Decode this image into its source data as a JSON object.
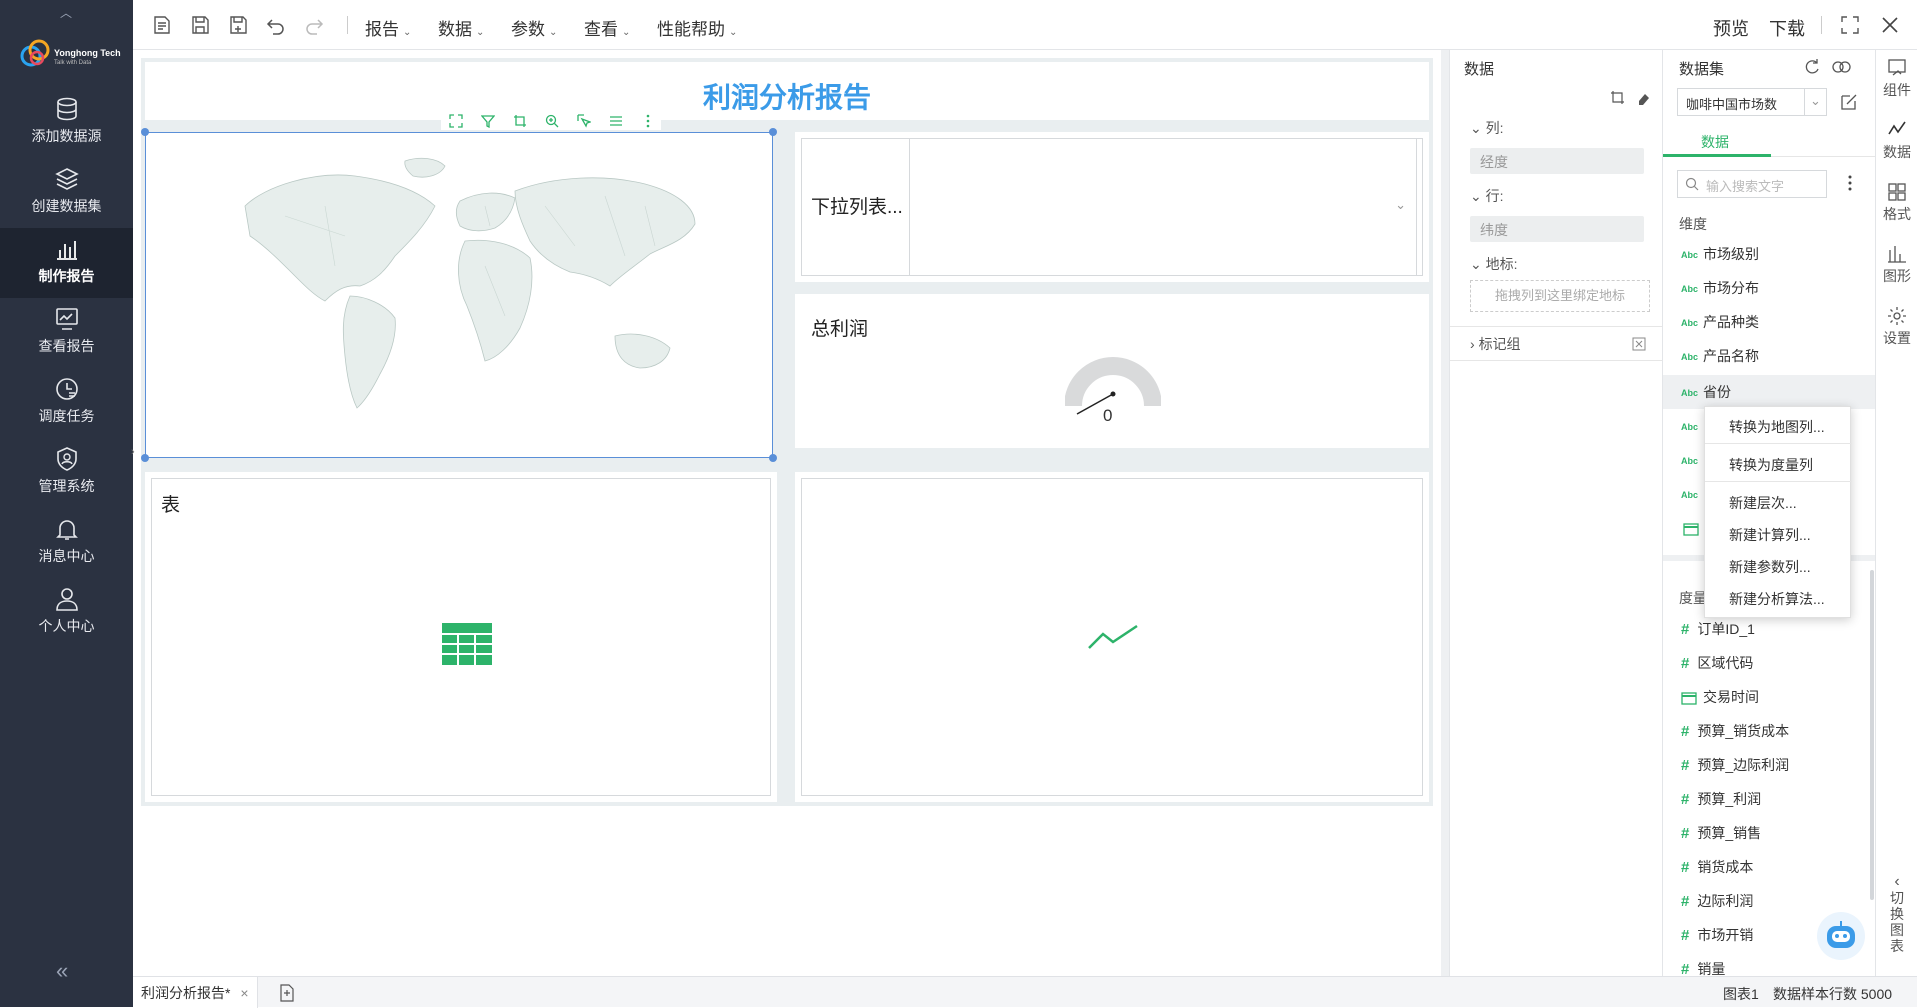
{
  "nav": {
    "logo_line1": "Yonghong Tech",
    "logo_line2": "Talk with Data",
    "items": [
      {
        "label": "添加数据源"
      },
      {
        "label": "创建数据集"
      },
      {
        "label": "制作报告"
      },
      {
        "label": "查看报告"
      },
      {
        "label": "调度任务"
      },
      {
        "label": "管理系统"
      },
      {
        "label": "消息中心"
      },
      {
        "label": "个人中心"
      }
    ],
    "collapse": "«"
  },
  "toolbar": {
    "menus": [
      {
        "label": "报告"
      },
      {
        "label": "数据"
      },
      {
        "label": "参数"
      },
      {
        "label": "查看"
      },
      {
        "label": "性能帮助"
      }
    ],
    "preview": "预览",
    "download": "下载"
  },
  "report": {
    "title": "利润分析报告",
    "dropdown_label": "下拉列表...",
    "gauge_label": "总利润",
    "gauge_value": "0",
    "table_label": "表"
  },
  "datapane": {
    "title": "数据",
    "col_label": "列:",
    "col_field": "经度",
    "row_label": "行:",
    "row_field": "纬度",
    "geo_label": "地标:",
    "geo_drop": "拖拽列到这里绑定地标",
    "marks_label": "标记组"
  },
  "setpane": {
    "title": "数据集",
    "dataset_value": "咖啡中国市场数",
    "tab_data": "数据",
    "search_placeholder": "输入搜索文字",
    "dim_header": "维度",
    "dimensions": [
      "市场级别",
      "市场分布",
      "产品种类",
      "产品名称",
      "省份"
    ],
    "measure_header": "度量",
    "measures": [
      "订单ID_1",
      "区域代码",
      "交易时间",
      "预算_销货成本",
      "预算_边际利润",
      "预算_利润",
      "预算_销售",
      "销货成本",
      "边际利润",
      "市场开销",
      "销量"
    ]
  },
  "context_menu": [
    "转换为地图列...",
    "转换为度量列",
    "新建层次...",
    "新建计算列...",
    "新建参数列...",
    "新建分析算法..."
  ],
  "rail": {
    "items": [
      "组件",
      "数据",
      "格式",
      "图形",
      "设置"
    ],
    "switch_label": [
      "切",
      "换",
      "图",
      "表"
    ]
  },
  "bottom": {
    "tab_name": "利润分析报告*",
    "close": "×",
    "status_chart": "图表1",
    "status_rows": "数据样本行数 5000"
  },
  "colors": {
    "nav_bg": "#2b3241",
    "accent_blue": "#3b9be8",
    "accent_green": "#2db36a"
  }
}
